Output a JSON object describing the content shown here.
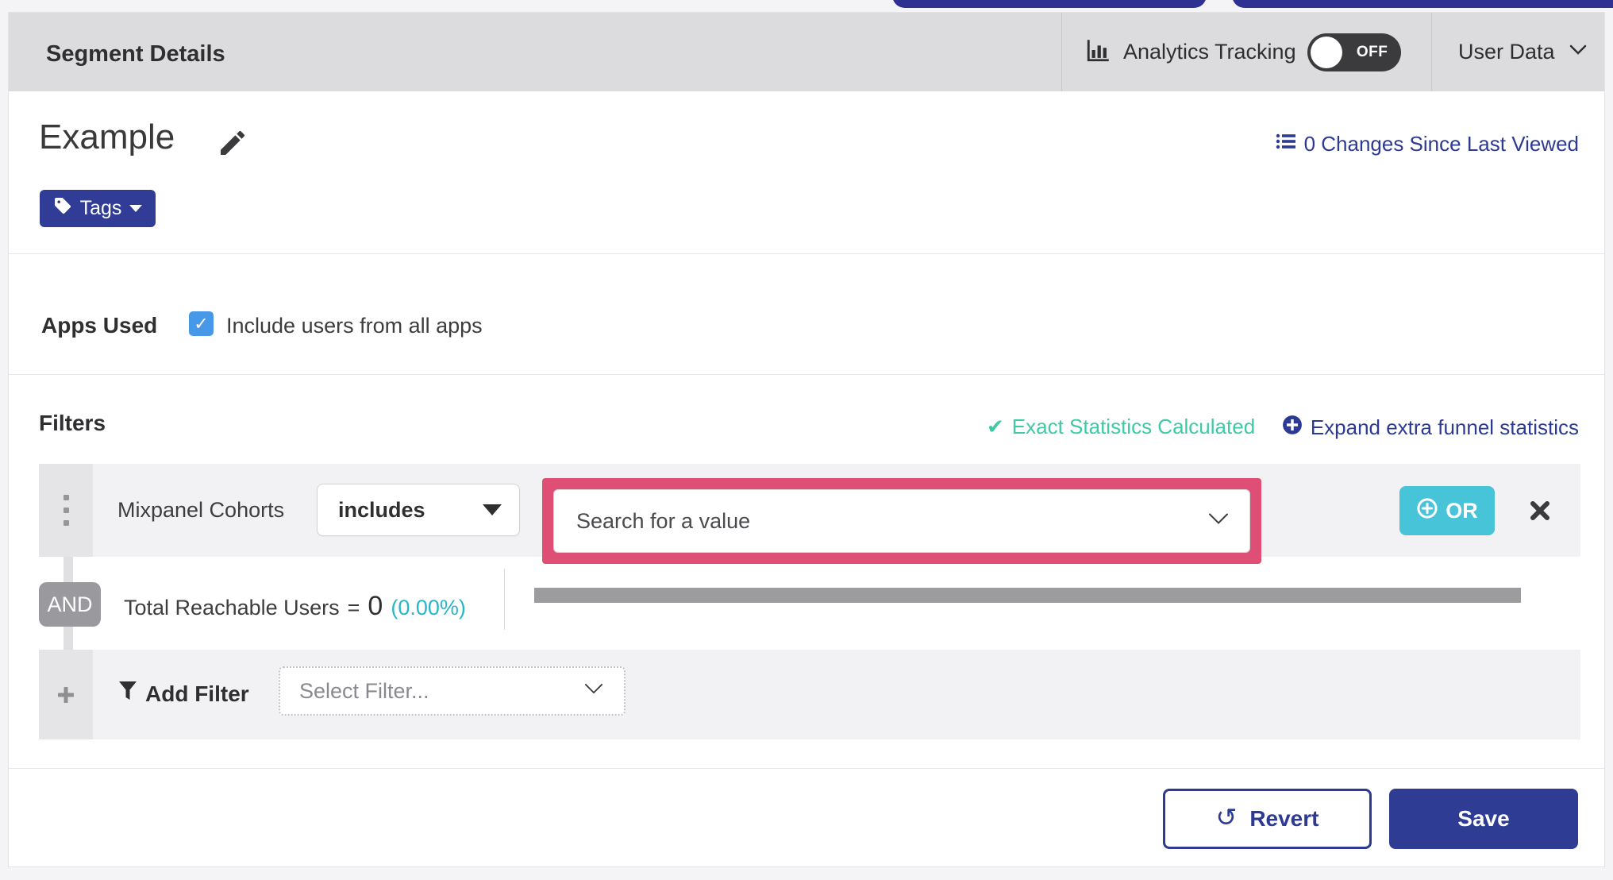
{
  "header": {
    "title": "Segment Details",
    "analytics_label": "Analytics Tracking",
    "toggle_state": "OFF",
    "user_data_label": "User Data"
  },
  "segment": {
    "name": "Example",
    "changes_link": "0 Changes Since Last Viewed",
    "tags_label": "Tags"
  },
  "apps_used": {
    "label": "Apps Used",
    "checkbox_label": "Include users from all apps",
    "checked": true
  },
  "filters": {
    "title": "Filters",
    "status": "Exact Statistics Calculated",
    "expand_link": "Expand extra funnel statistics",
    "rows": [
      {
        "name": "Mixpanel Cohorts",
        "operator": "includes",
        "value_placeholder": "Search for a value",
        "or_label": "OR"
      }
    ],
    "and_label": "AND",
    "reachable": {
      "label": "Total Reachable Users",
      "equals": "=",
      "value": "0",
      "percent": "(0.00%)",
      "progress_fraction": 0
    },
    "add_filter": {
      "label": "Add Filter",
      "placeholder": "Select Filter..."
    }
  },
  "footer": {
    "revert_label": "Revert",
    "save_label": "Save"
  },
  "colors": {
    "navy": "#2d3a93",
    "pill_navy": "#2e3192",
    "or_cyan": "#47c4d8",
    "status_teal": "#3ec9a7",
    "percent_cyan": "#2ab6c9",
    "highlight_pink": "#df4e74",
    "checkbox_blue": "#4798e8",
    "toggle_dark": "#3b3b3e"
  }
}
